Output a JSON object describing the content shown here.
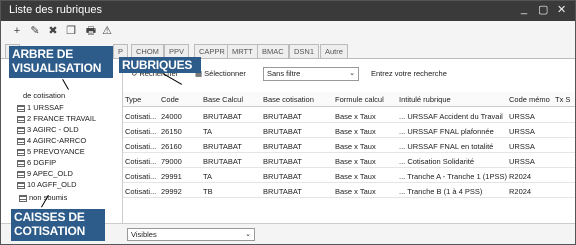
{
  "window": {
    "title": "Liste des rubriques",
    "minimize": "_",
    "restore": "▢",
    "close": "✕"
  },
  "toolbar": {
    "icons": [
      "add-icon",
      "edit-icon",
      "delete-icon",
      "copy-icon",
      "print-icon",
      "export-icon"
    ],
    "glyphs": [
      "+",
      "✎",
      "✖",
      "❐",
      "🖶",
      "⚠"
    ]
  },
  "tabs": [
    "T",
    "P",
    "CHOM",
    "PPV",
    "CAPPR",
    "MRTT",
    "BMAC",
    "DSN1",
    "Autre"
  ],
  "tree": {
    "root": "de cotisation",
    "items": [
      "1 URSSAF",
      "2 FRANCE TRAVAIL",
      "3 AGIRC - OLD",
      "4 AGIRC-ARRCO",
      "5 PREVOYANCE",
      "6 DGFIP",
      "9 APEC_OLD",
      "10 AGFF_OLD"
    ],
    "footer": "non soumis"
  },
  "annotations": {
    "tree_label_1": "ARBRE DE",
    "tree_label_2": "VISUALISATION",
    "rubriques": "RUBRIQUES",
    "caisses_1": "CAISSES DE",
    "caisses_2": "COTISATION"
  },
  "filters": {
    "refresh": "Rechercher",
    "select": "Sélectionner",
    "filter_value": "Sans filtre",
    "search_prompt": "Entrez votre recherche"
  },
  "grid": {
    "columns": [
      "Type",
      "Code",
      "Base Calcul",
      "Base cotisation",
      "Formule calcul",
      "Intitulé rubrique",
      "Code mémo",
      "Tx S"
    ],
    "rows": [
      [
        "Cotisati...",
        "24000",
        "BRUTABAT",
        "BRUTABAT",
        "Base x Taux",
        "... URSSAF Accident du Travail",
        "URSSA",
        ""
      ],
      [
        "Cotisati...",
        "26150",
        "TA",
        "BRUTABAT",
        "Base x Taux",
        "... URSSAF FNAL plafonnée",
        "URSSA",
        ""
      ],
      [
        "Cotisati...",
        "26160",
        "BRUTABAT",
        "BRUTABAT",
        "Base x Taux",
        "... URSSAF FNAL en totalité",
        "URSSA",
        ""
      ],
      [
        "Cotisati...",
        "79000",
        "BRUTABAT",
        "BRUTABAT",
        "Base x Taux",
        "... Cotisation Solidarité",
        "URSSA",
        ""
      ],
      [
        "Cotisati...",
        "29991",
        "TA",
        "BRUTABAT",
        "Base x Taux",
        "... Tranche A - Tranche 1 (1PSS)",
        "R2024",
        ""
      ],
      [
        "Cotisati...",
        "29992",
        "TB",
        "BRUTABAT",
        "Base x Taux",
        "... Tranche B (1 à 4 PSS)",
        "R2024",
        ""
      ]
    ]
  },
  "bottom": {
    "visibility": "Visibles"
  }
}
